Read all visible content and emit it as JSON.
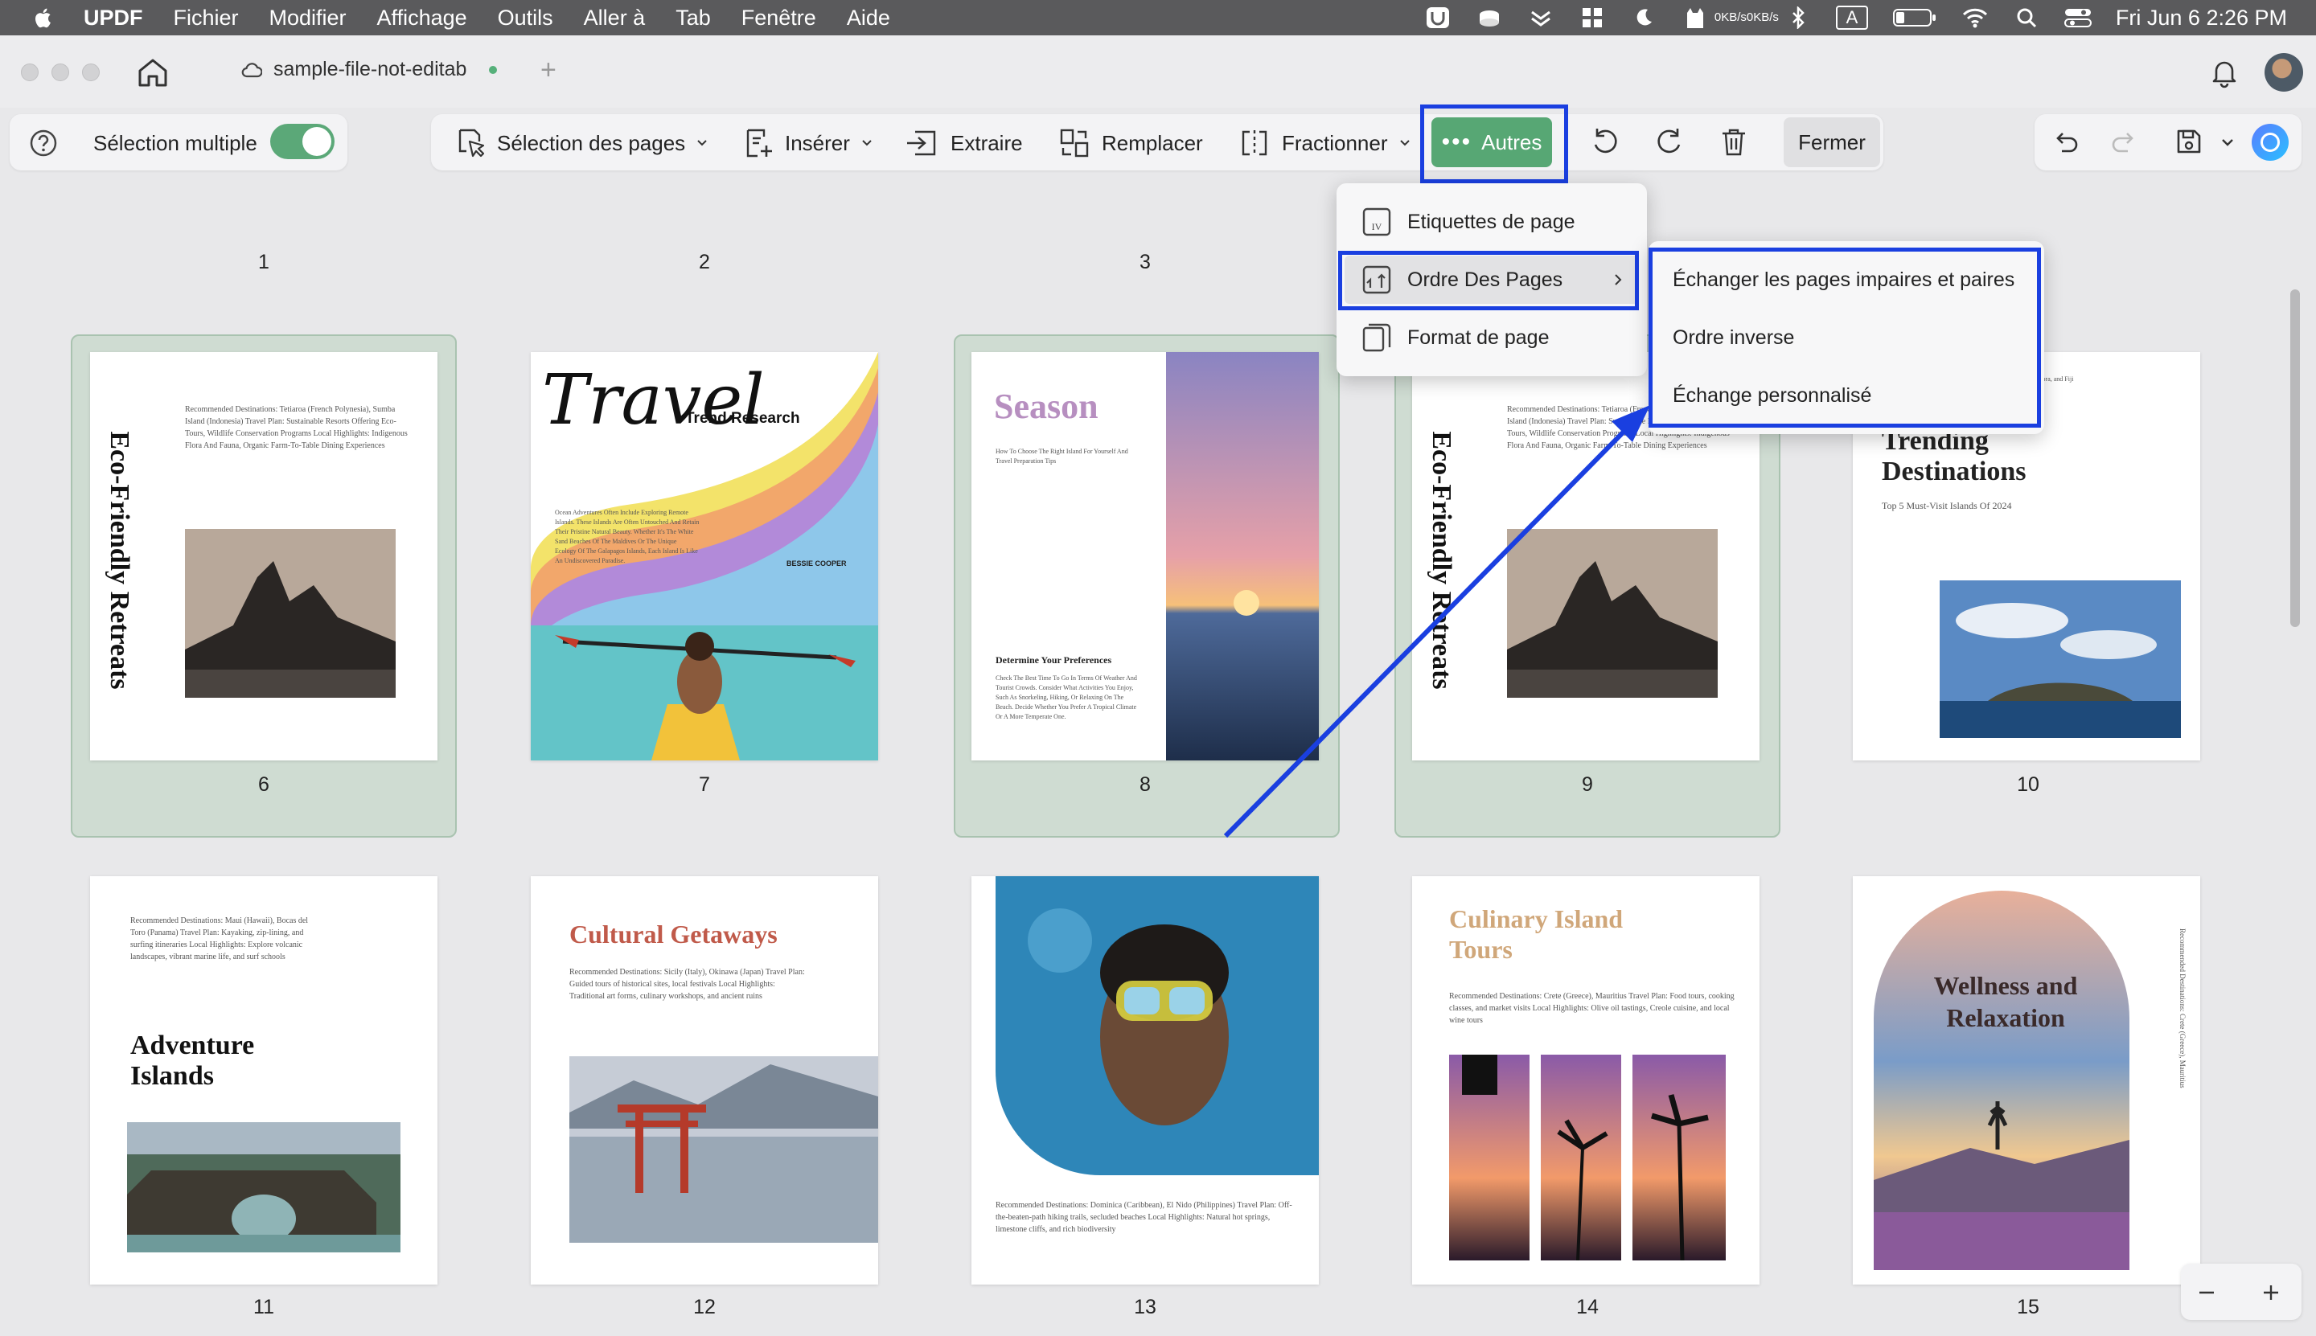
{
  "menubar": {
    "app": "UPDF",
    "items": [
      "Fichier",
      "Modifier",
      "Affichage",
      "Outils",
      "Aller à",
      "Tab",
      "Fenêtre",
      "Aide"
    ],
    "net_up": "0KB/s",
    "net_down": "0KB/s",
    "input_source": "A",
    "clock": "Fri Jun 6  2:26 PM"
  },
  "tab": {
    "title": "sample-file-not-editab"
  },
  "toolbar": {
    "multi_select_label": "Sélection multiple",
    "multi_select_on": true,
    "page_selection_label": "Sélection des pages",
    "insert_label": "Insérer",
    "extract_label": "Extraire",
    "replace_label": "Remplacer",
    "split_label": "Fractionner",
    "others_label": "Autres",
    "close_label": "Fermer"
  },
  "others_menu": {
    "items": [
      "Etiquettes de page",
      "Ordre Des Pages",
      "Format de page"
    ]
  },
  "order_submenu": {
    "items": [
      "Échanger les pages impaires et paires",
      "Ordre inverse",
      "Échange personnalisé"
    ]
  },
  "pages": {
    "top_row_numbers": [
      "1",
      "2",
      "3"
    ],
    "row1": [
      "6",
      "7",
      "8",
      "9",
      "10"
    ],
    "row2": [
      "11",
      "12",
      "13",
      "14",
      "15"
    ],
    "selected": [
      "6",
      "8",
      "9"
    ]
  },
  "thumbs": {
    "p6": {
      "title": "Eco-Friendly Retreats",
      "text": "Recommended Destinations: Tetiaroa (French Polynesia), Sumba Island (Indonesia) Travel Plan: Sustainable Resorts Offering Eco-Tours, Wildlife Conservation Programs Local Highlights: Indigenous Flora And Fauna, Organic Farm-To-Table Dining Experiences"
    },
    "p7": {
      "script": "Travel",
      "subtitle": "Trend Research",
      "author": "BESSIE COOPER",
      "text": "Ocean Adventures Often Include Exploring Remote Islands. These Islands Are Often Untouched And Retain Their Pristine Natural Beauty. Whether It's The White Sand Beaches Of The Maldives Or The Unique Ecology Of The Galapagos Islands, Each Island Is Like An Undiscovered Paradise."
    },
    "p8": {
      "title": "Season",
      "intro": "How To Choose The Right Island For Yourself And Travel Preparation Tips",
      "heading": "Determine Your Preferences",
      "text": "Check The Best Time To Go In Terms Of Weather And Tourist Crowds. Consider What Activities You Enjoy, Such As Snorkeling, Hiking, Or Relaxing On The Beach. Decide Whether You Prefer A Tropical Climate Or A More Temperate One."
    },
    "p9": {
      "title": "Eco-Friendly Retreats",
      "text": "Recommended Destinations: Tetiaroa (French Polynesia), Sumba Island (Indonesia) Travel Plan: Sustainable Resorts Offering Eco-Tours, Wildlife Conservation Programs Local Highlights: Indigenous Flora And Fauna, Organic Farm-To-Table Dining Experiences"
    },
    "p10": {
      "top_text": "Recommended Destinations: Bali, Maldives, Santorini, Bora Bora, and Fiji",
      "title": "Trending Destinations",
      "subtitle": "Top 5 Must-Visit Islands Of 2024"
    },
    "p11": {
      "text": "Recommended Destinations: Maui (Hawaii), Bocas del Toro (Panama) Travel Plan: Kayaking, zip-lining, and surfing itineraries Local Highlights: Explore volcanic landscapes, vibrant marine life, and surf schools",
      "title": "Adventure Islands"
    },
    "p12": {
      "title": "Cultural Getaways",
      "text": "Recommended Destinations: Sicily (Italy), Okinawa (Japan) Travel Plan: Guided tours of historical sites, local festivals Local Highlights: Traditional art forms, culinary workshops, and ancient ruins"
    },
    "p13": {
      "text": "Recommended Destinations: Dominica (Caribbean), El Nido (Philippines) Travel Plan: Off-the-beaten-path hiking trails, secluded beaches Local Highlights: Natural hot springs, limestone cliffs, and rich biodiversity"
    },
    "p14": {
      "title": "Culinary Island Tours",
      "text": "Recommended Destinations: Crete (Greece), Mauritius Travel Plan: Food tours, cooking classes, and market visits Local Highlights: Olive oil tastings, Creole cuisine, and local wine tours"
    },
    "p15": {
      "title": "Wellness and Relaxation",
      "side_text": "Recommended Destinations: Crete (Greece), Mauritius"
    }
  },
  "colors": {
    "accent_green": "#57a774",
    "highlight_blue": "#1a3fe0",
    "selection_fill": "#cfdcd2"
  }
}
